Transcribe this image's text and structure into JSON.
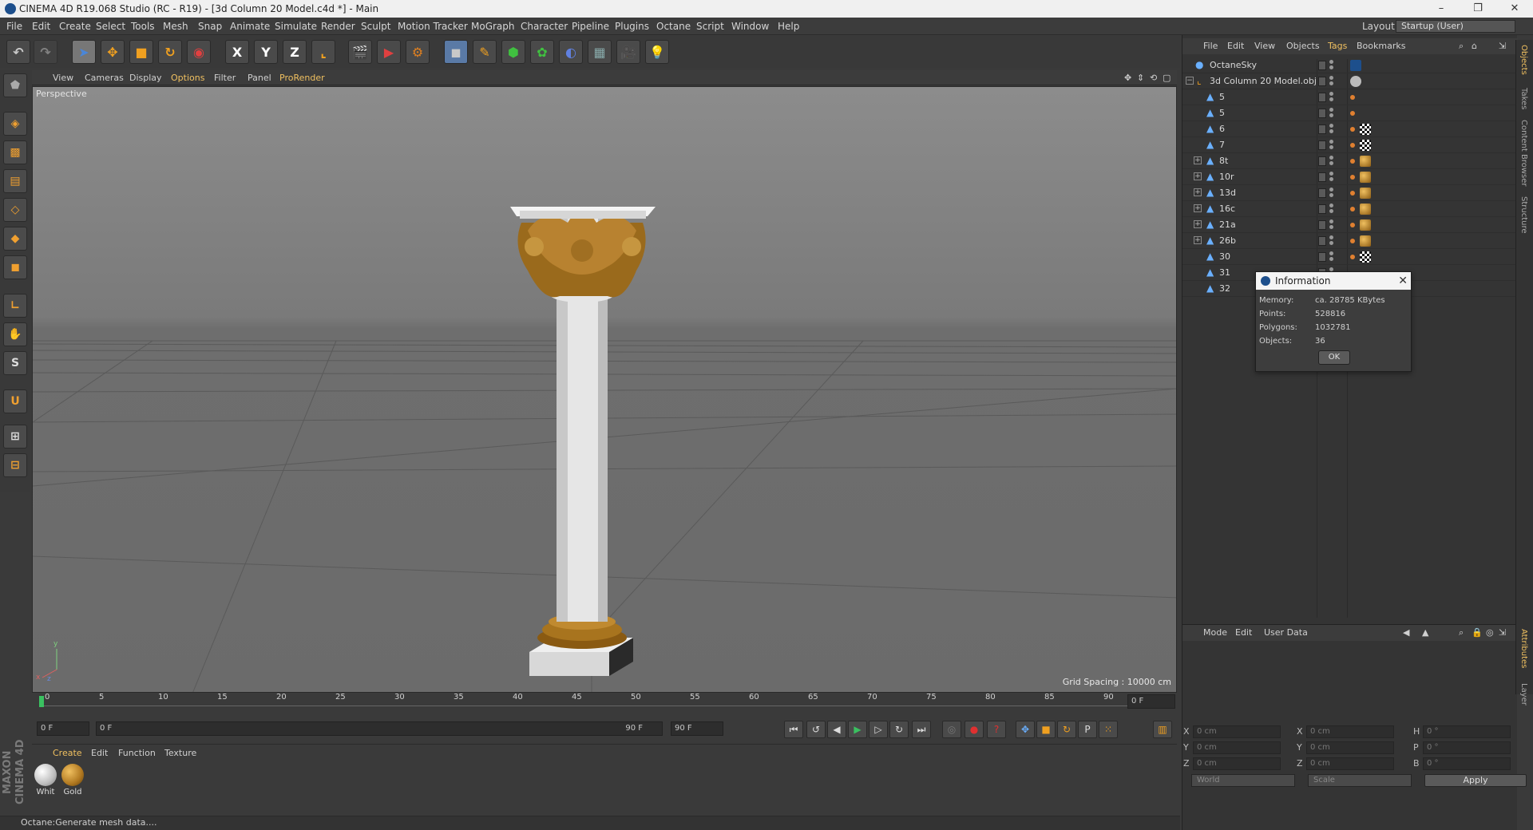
{
  "window": {
    "title": "CINEMA 4D R19.068 Studio (RC - R19) - [3d Column 20 Model.c4d *] - Main",
    "minimize": "–",
    "maximize": "❐",
    "close": "✕"
  },
  "menubar": {
    "items": [
      "File",
      "Edit",
      "Create",
      "Select",
      "Tools",
      "Mesh",
      "Snap",
      "Animate",
      "Simulate",
      "Render",
      "Sculpt",
      "Motion Tracker",
      "MoGraph",
      "Character",
      "Pipeline",
      "Plugins",
      "Octane",
      "Script",
      "Window",
      "Help"
    ],
    "layout_label": "Layout:",
    "layout_value": "Startup (User)"
  },
  "viewport": {
    "menu": [
      "View",
      "Cameras",
      "Display",
      "Options",
      "Filter",
      "Panel",
      "ProRender"
    ],
    "camera_label": "Perspective",
    "grid_spacing": "Grid Spacing : 10000 cm"
  },
  "timeline": {
    "ticks": [
      "0",
      "5",
      "10",
      "15",
      "20",
      "25",
      "30",
      "35",
      "40",
      "45",
      "50",
      "55",
      "60",
      "65",
      "70",
      "75",
      "80",
      "85",
      "90"
    ],
    "current_frame": "0 F",
    "start_field": "0 F",
    "range_start": "0 F",
    "range_end": "90 F",
    "end_field": "90 F"
  },
  "materials": {
    "menu": [
      "Create",
      "Edit",
      "Function",
      "Texture"
    ],
    "items": [
      {
        "name": "Whit",
        "color": "#e8e8e8"
      },
      {
        "name": "Gold",
        "color": "#b07820"
      }
    ]
  },
  "brand": {
    "logo": "MAXON CINEMA 4D"
  },
  "status": {
    "text": "Octane:Generate mesh data...."
  },
  "objects": {
    "menu": [
      "File",
      "Edit",
      "View",
      "Objects",
      "Tags",
      "Bookmarks"
    ],
    "rows": [
      {
        "name": "OctaneSky",
        "indent": 0,
        "expander": ""
      },
      {
        "name": "3d Column 20 Model.obj",
        "indent": 0,
        "expander": "−"
      },
      {
        "name": "5",
        "indent": 1,
        "expander": ""
      },
      {
        "name": "5",
        "indent": 1,
        "expander": ""
      },
      {
        "name": "6",
        "indent": 1,
        "expander": ""
      },
      {
        "name": "7",
        "indent": 1,
        "expander": ""
      },
      {
        "name": "8t",
        "indent": 1,
        "expander": "+"
      },
      {
        "name": "10r",
        "indent": 1,
        "expander": "+"
      },
      {
        "name": "13d",
        "indent": 1,
        "expander": "+"
      },
      {
        "name": "16c",
        "indent": 1,
        "expander": "+"
      },
      {
        "name": "21a",
        "indent": 1,
        "expander": "+"
      },
      {
        "name": "26b",
        "indent": 1,
        "expander": "+"
      },
      {
        "name": "30",
        "indent": 1,
        "expander": ""
      },
      {
        "name": "31",
        "indent": 1,
        "expander": ""
      },
      {
        "name": "32",
        "indent": 1,
        "expander": ""
      }
    ]
  },
  "info_dialog": {
    "title": "Information",
    "memory_label": "Memory:",
    "memory_value": "ca. 28785 KBytes",
    "points_label": "Points:",
    "points_value": "528816",
    "polygons_label": "Polygons:",
    "polygons_value": "1032781",
    "objects_label": "Objects:",
    "objects_value": "36",
    "ok": "OK"
  },
  "attributes": {
    "menu": [
      "Mode",
      "Edit",
      "User Data"
    ],
    "pos": [
      {
        "axis": "X",
        "value": "0 cm"
      },
      {
        "axis": "Y",
        "value": "0 cm"
      },
      {
        "axis": "Z",
        "value": "0 cm"
      }
    ],
    "size": [
      {
        "axis": "X",
        "value": "0 cm"
      },
      {
        "axis": "Y",
        "value": "0 cm"
      },
      {
        "axis": "Z",
        "value": "0 cm"
      }
    ],
    "rot": [
      {
        "axis": "H",
        "value": "0 °"
      },
      {
        "axis": "P",
        "value": "0 °"
      },
      {
        "axis": "B",
        "value": "0 °"
      }
    ],
    "world": "World",
    "scale": "Scale",
    "apply": "Apply"
  },
  "sidetabs": [
    "Objects",
    "Takes",
    "Content Browser",
    "Structure",
    "Attributes",
    "Layer"
  ],
  "colors": {
    "accent": "#f0c060",
    "gold": "#b07820",
    "column": "#e6e6e6"
  }
}
